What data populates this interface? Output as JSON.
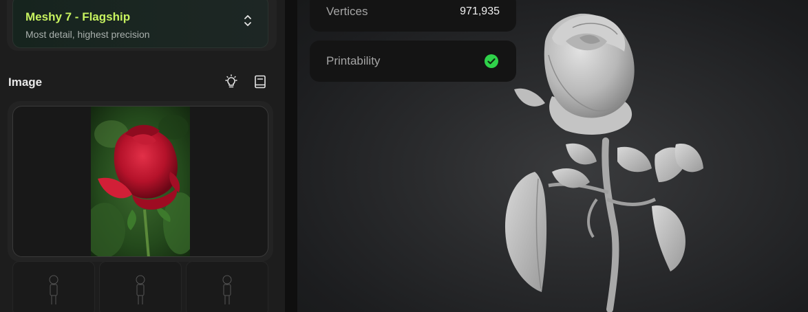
{
  "model_selector": {
    "name": "Meshy 7 - Flagship",
    "description": "Most detail, highest precision"
  },
  "image_section": {
    "title": "Image",
    "tip_icon": "lightbulb-icon",
    "guide_icon": "book-icon"
  },
  "stats": {
    "vertices_label": "Vertices",
    "vertices_value": "971,935",
    "printability_label": "Printability",
    "printability_status": "check-circle-icon"
  },
  "colors": {
    "accent_green": "#c7f25f",
    "status_green": "#2fd24a"
  }
}
